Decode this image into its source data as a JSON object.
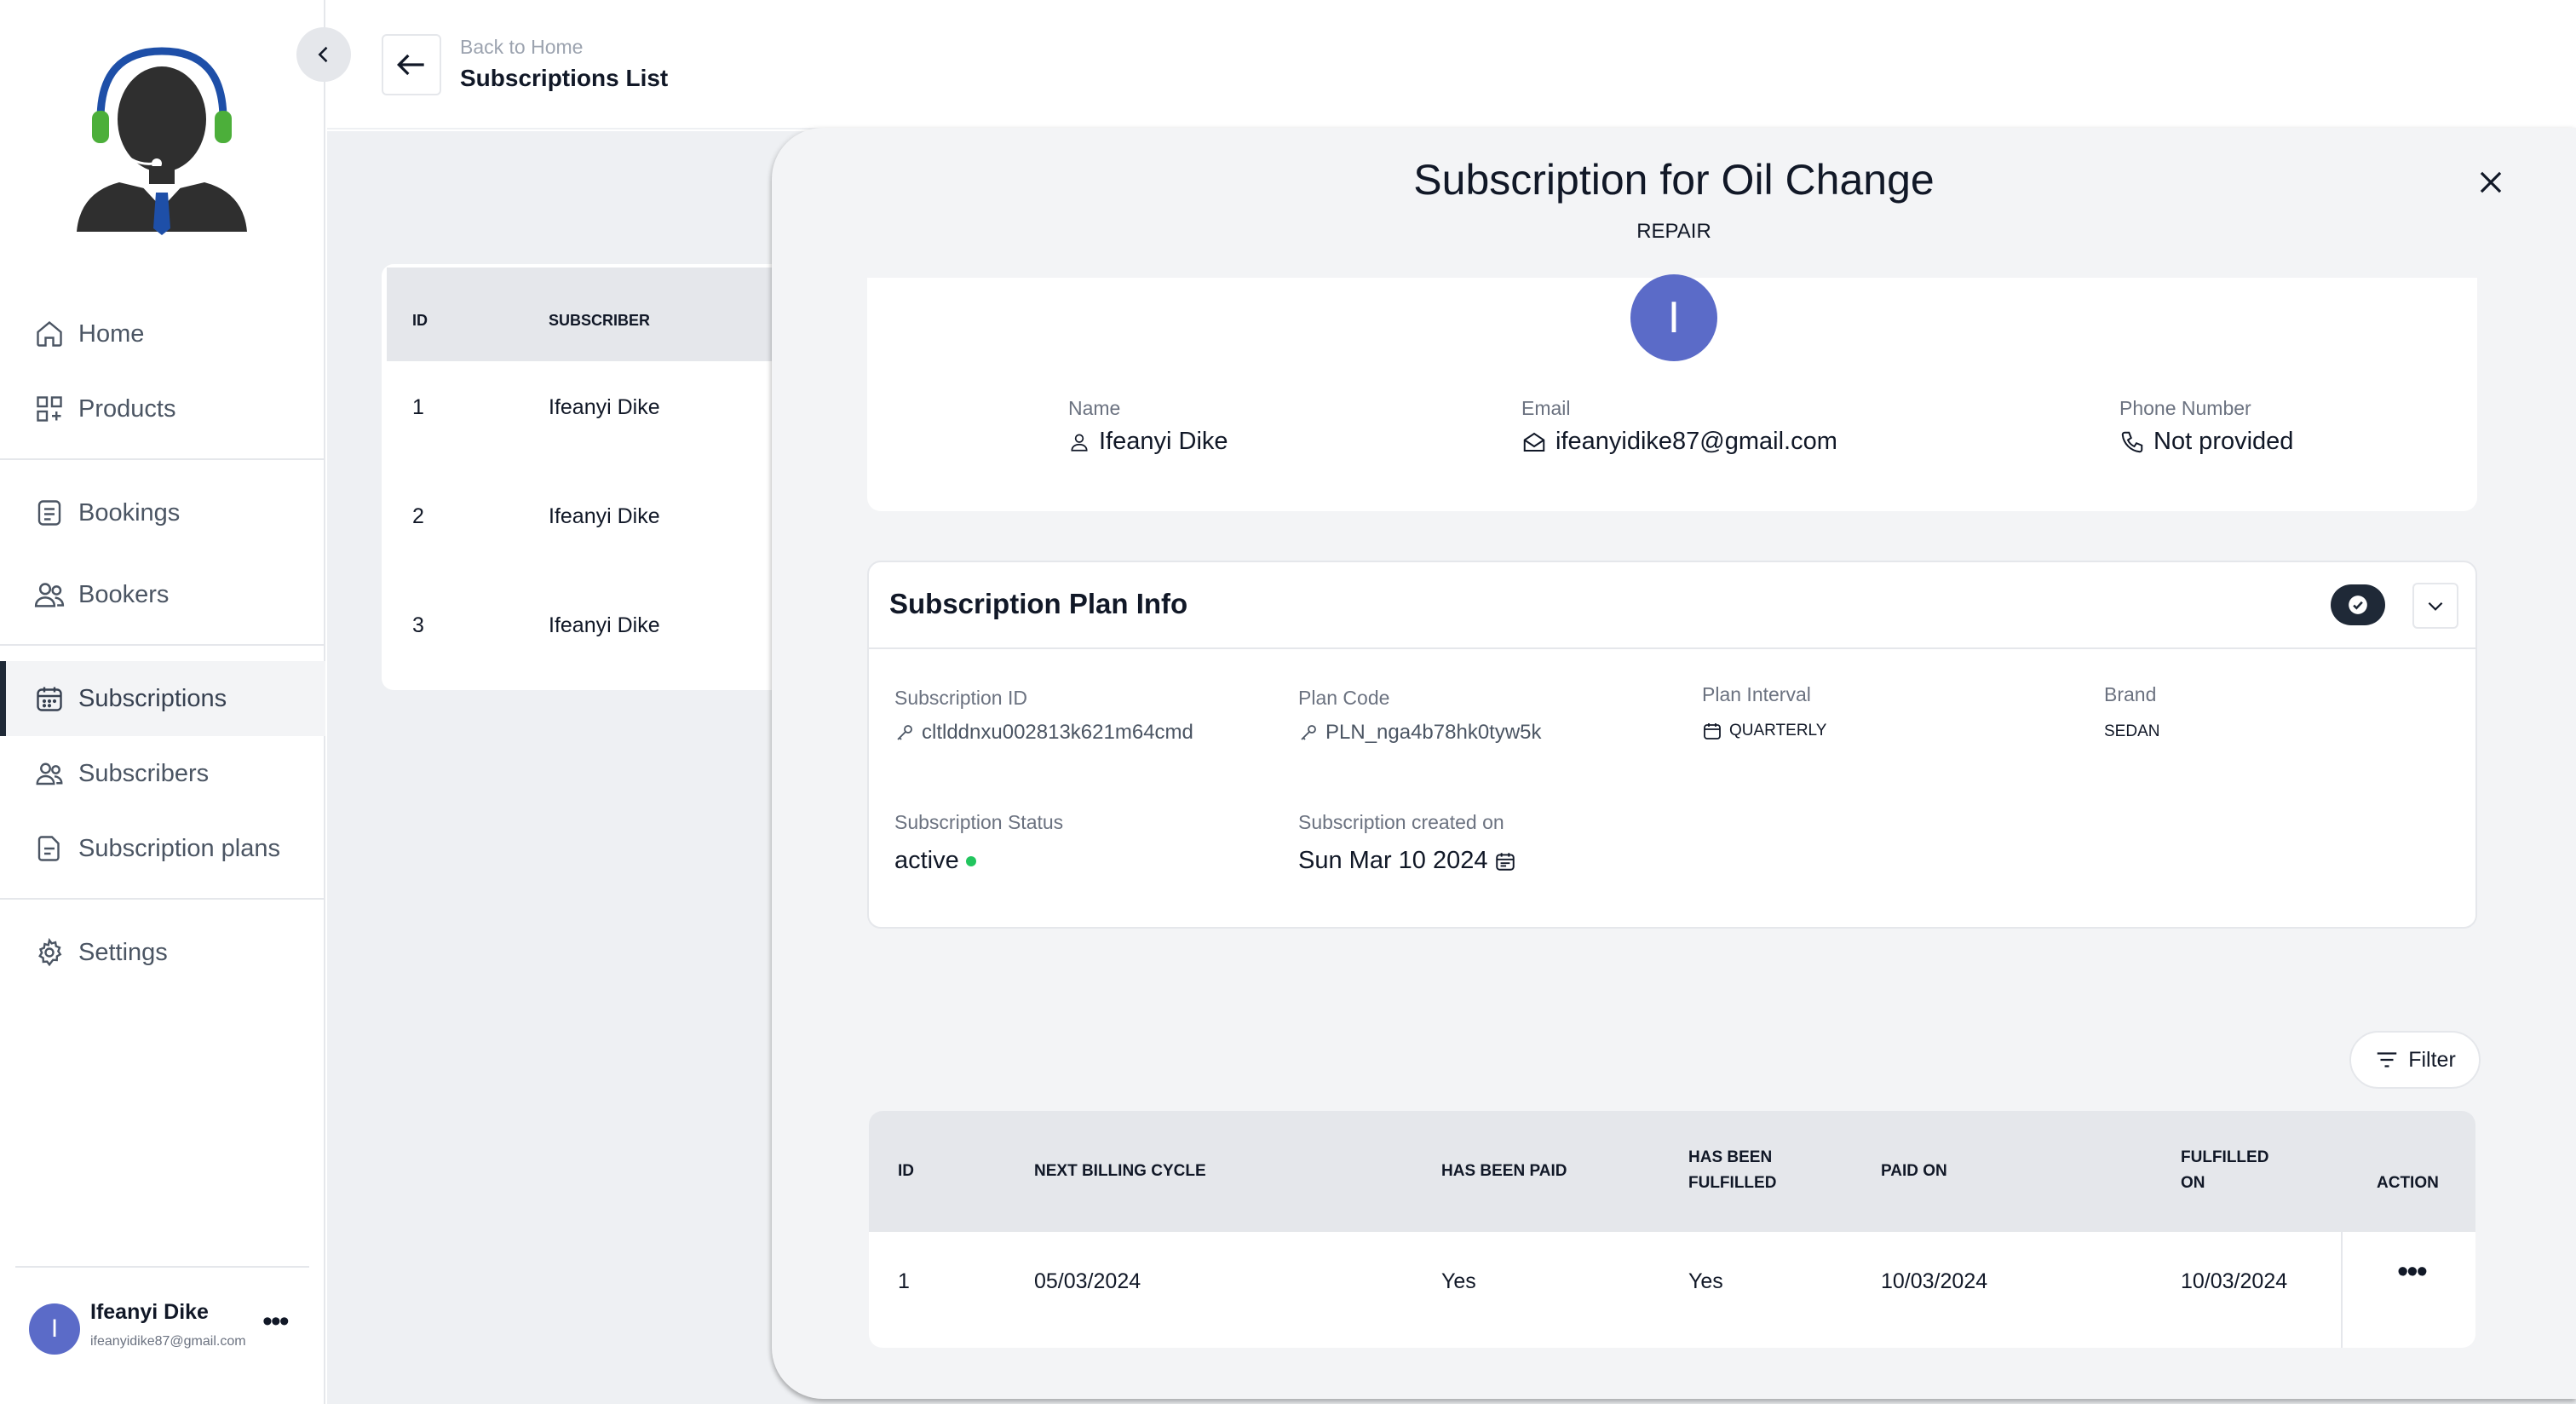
{
  "sidebar": {
    "nav": [
      {
        "label": "Home",
        "icon": "home-icon"
      },
      {
        "label": "Products",
        "icon": "grid-plus-icon"
      },
      {
        "label": "Bookings",
        "icon": "document-icon"
      },
      {
        "label": "Bookers",
        "icon": "users-icon"
      },
      {
        "label": "Subscriptions",
        "icon": "calendar-icon",
        "active": true
      },
      {
        "label": "Subscribers",
        "icon": "users-icon"
      },
      {
        "label": "Subscription plans",
        "icon": "document-icon"
      },
      {
        "label": "Settings",
        "icon": "gear-icon"
      }
    ],
    "user": {
      "initial": "I",
      "name": "Ifeanyi Dike",
      "email": "ifeanyidike87@gmail.com"
    }
  },
  "header": {
    "breadcrumb": "Back to Home",
    "title": "Subscriptions List"
  },
  "list": {
    "columns": [
      "ID",
      "SUBSCRIBER"
    ],
    "rows": [
      {
        "id": "1",
        "subscriber": "Ifeanyi Dike"
      },
      {
        "id": "2",
        "subscriber": "Ifeanyi Dike"
      },
      {
        "id": "3",
        "subscriber": "Ifeanyi Dike"
      }
    ]
  },
  "drawer": {
    "title": "Subscription for Oil Change",
    "subtitle": "REPAIR",
    "profile": {
      "initial": "I",
      "name_label": "Name",
      "name": "Ifeanyi Dike",
      "email_label": "Email",
      "email": "ifeanyidike87@gmail.com",
      "phone_label": "Phone Number",
      "phone": "Not provided"
    },
    "plan": {
      "title": "Subscription Plan Info",
      "subscription_id_label": "Subscription ID",
      "subscription_id": "cltlddnxu002813k621m64cmd",
      "plan_code_label": "Plan Code",
      "plan_code": "PLN_nga4b78hk0tyw5k",
      "interval_label": "Plan Interval",
      "interval": "QUARTERLY",
      "brand_label": "Brand",
      "brand": "SEDAN",
      "status_label": "Subscription Status",
      "status": "active",
      "created_label": "Subscription created on",
      "created": "Sun Mar 10 2024"
    },
    "filter_label": "Filter",
    "billing": {
      "headers": {
        "id": "ID",
        "next_billing": "NEXT BILLING CYCLE",
        "paid": "HAS BEEN PAID",
        "fulfilled_1": "HAS BEEN",
        "fulfilled_2": "FULFILLED",
        "paid_on": "PAID ON",
        "fulfilled_on_1": "FULFILLED",
        "fulfilled_on_2": "ON",
        "action": "ACTION"
      },
      "row": {
        "id": "1",
        "next_billing": "05/03/2024",
        "paid": "Yes",
        "fulfilled": "Yes",
        "paid_on": "10/03/2024",
        "fulfilled_on": "10/03/2024"
      }
    }
  },
  "colors": {
    "accent": "#5b6bc8",
    "status_active": "#22c55e",
    "headset": "#1e4fa8",
    "ear": "#4caf3a"
  }
}
